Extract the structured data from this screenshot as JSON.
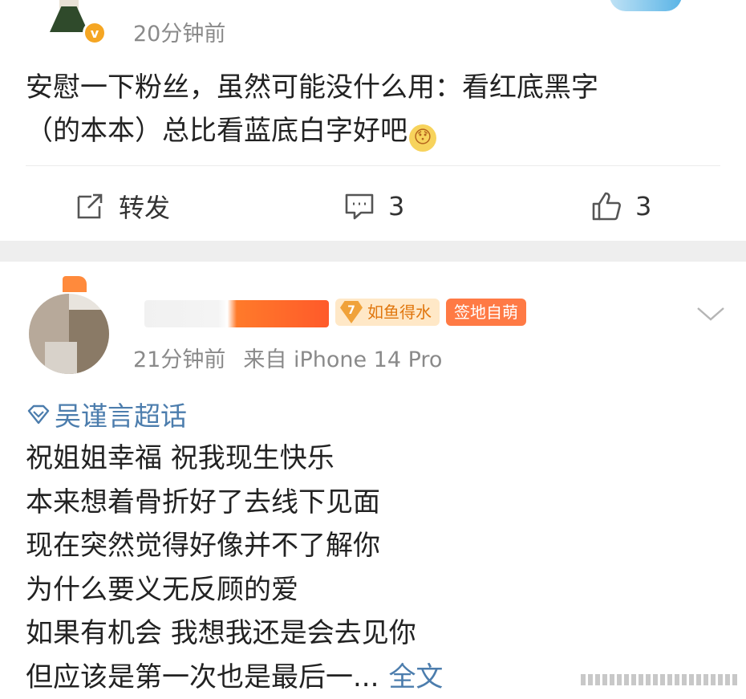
{
  "post1": {
    "time": "20分钟前",
    "verified_badge": "v",
    "body_line1": "安慰一下粉丝，虽然可能没什么用：看红底黑字",
    "body_line2": "（的本本）总比看蓝底白字好吧",
    "emoji": "😯",
    "actions": {
      "repost_label": "转发",
      "comment_count": "3",
      "like_count": "3"
    }
  },
  "post2": {
    "badges": {
      "level_number": "7",
      "level_label": "如鱼得水",
      "tag_label": "签地自萌"
    },
    "time": "21分钟前",
    "source": "来自 iPhone 14 Pro",
    "topic": "吴谨言超话",
    "lines": [
      "祝姐姐幸福 祝我现生快乐",
      "本来想着骨折好了去线下见面",
      "现在突然觉得好像并不了解你",
      "为什么要义无反顾的爱",
      "如果有机会 我想我还是会去见你",
      "但应该是第一次也是最后一..."
    ],
    "full_text_link": "全文"
  },
  "colors": {
    "link_blue": "#4c7dad",
    "meta_gray": "#8a8a8a",
    "badge_orange": "#ff7a45",
    "level_bg": "#ffe8c7",
    "verified_orange": "#f5a623"
  },
  "icons": [
    "repost-icon",
    "comment-icon",
    "like-icon",
    "chevron-down-icon",
    "topic-diamond-icon",
    "verified-icon",
    "level-gem-icon"
  ]
}
